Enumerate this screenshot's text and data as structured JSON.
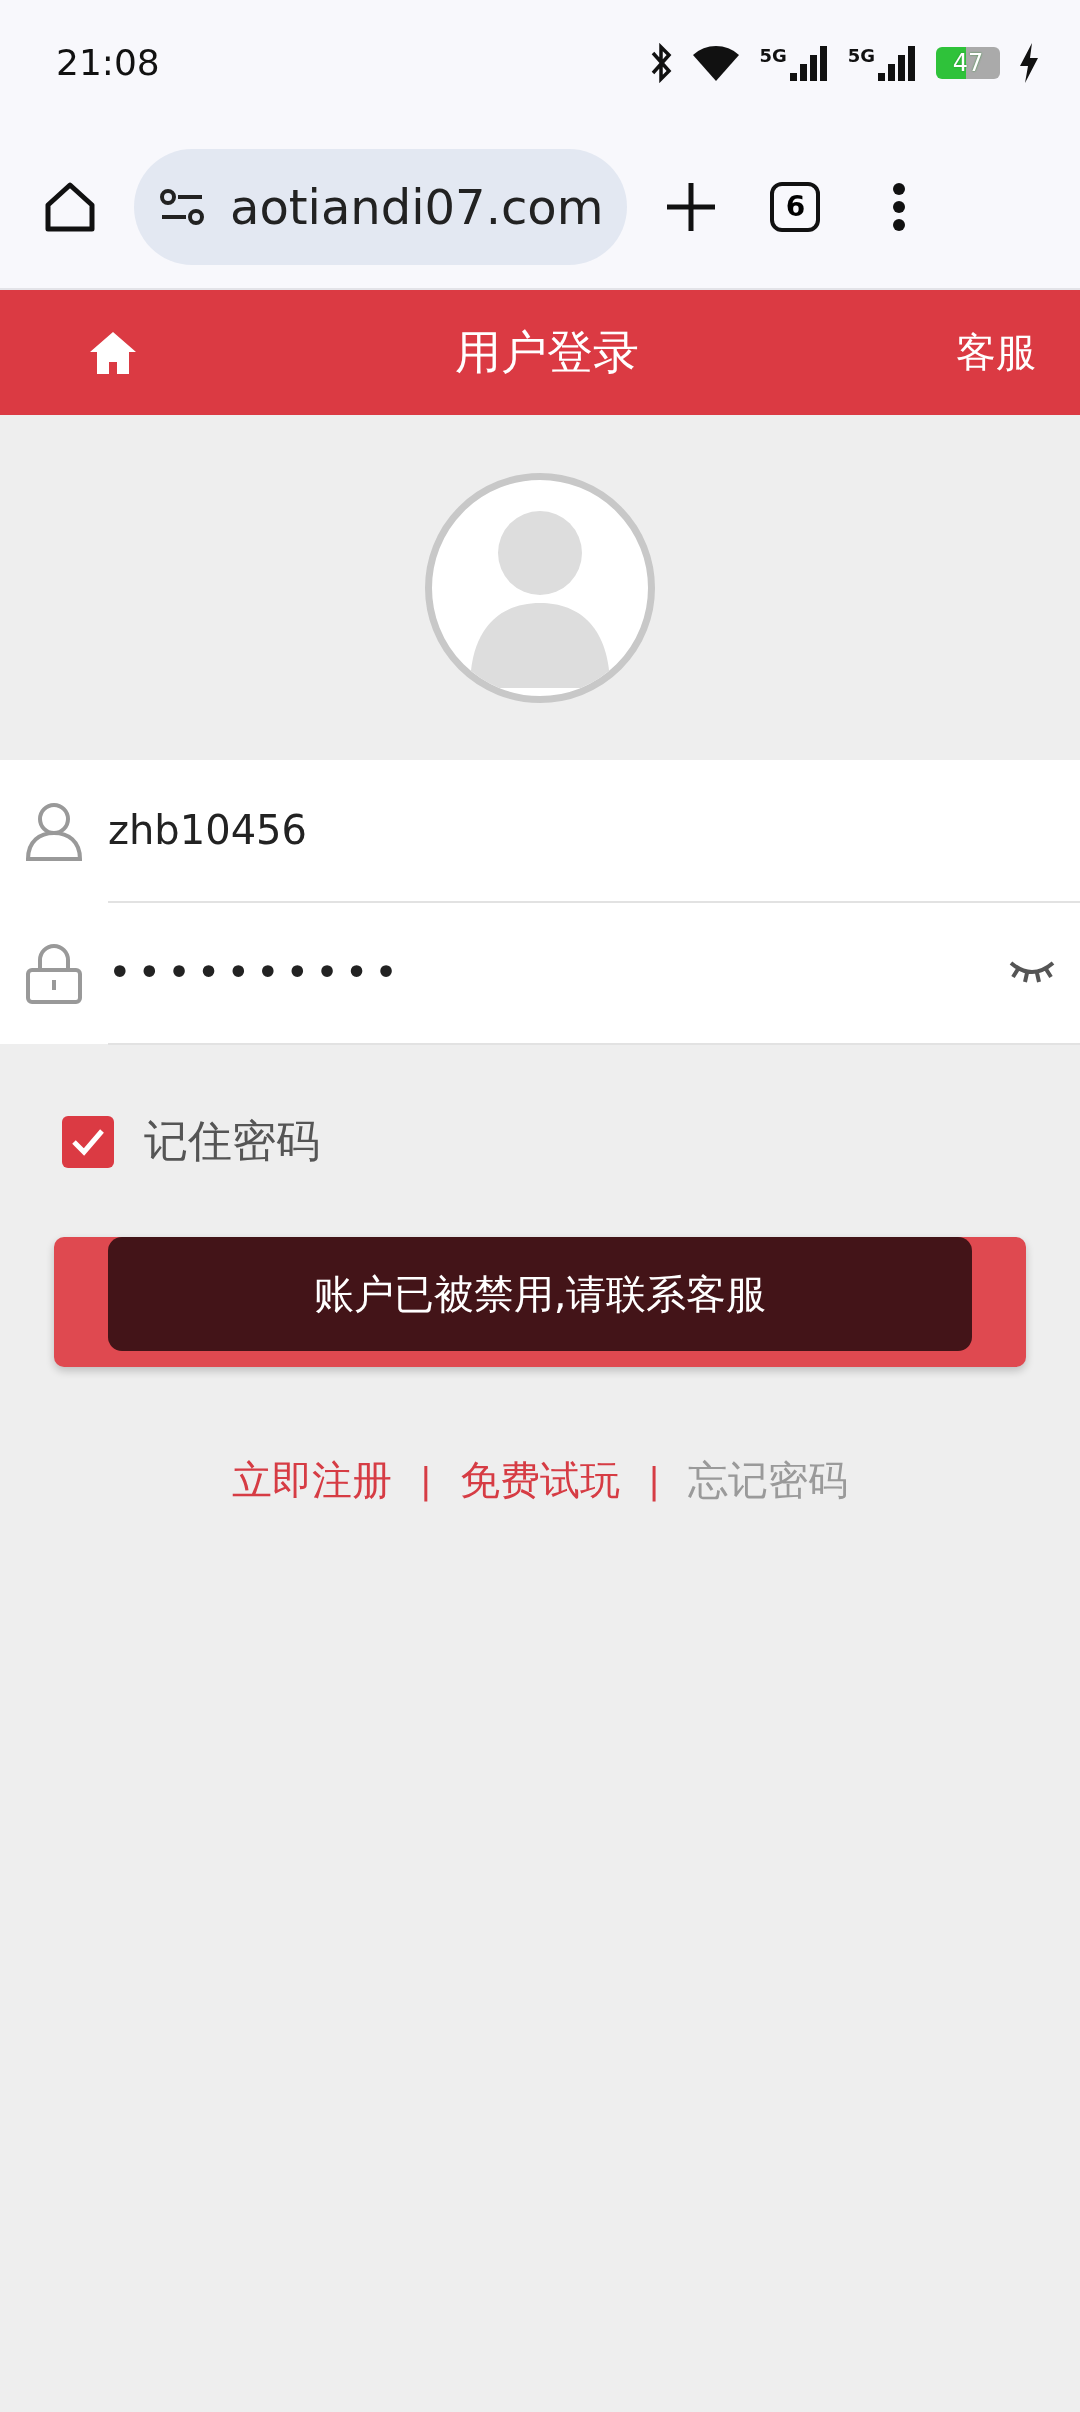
{
  "status_bar": {
    "time": "21:08",
    "network_1": "5G",
    "network_2": "5G",
    "battery": "47"
  },
  "browser": {
    "url": "aotiandi07.com",
    "tab_count": "6"
  },
  "header": {
    "title": "用户登录",
    "service": "客服"
  },
  "form": {
    "username": "zhb10456",
    "password": "••••••••••",
    "remember": {
      "label": "记住密码",
      "checked": true
    }
  },
  "toast": "账户已被禁用,请联系客服",
  "links": [
    {
      "kind": "link",
      "label": "立即注册",
      "color": "#d63c44"
    },
    {
      "kind": "separator",
      "label": "|"
    },
    {
      "kind": "link",
      "label": "免费试玩",
      "color": "#d63c44"
    },
    {
      "kind": "separator",
      "label": "|"
    },
    {
      "kind": "link",
      "label": "忘记密码",
      "color": "#9a9a9a"
    }
  ]
}
